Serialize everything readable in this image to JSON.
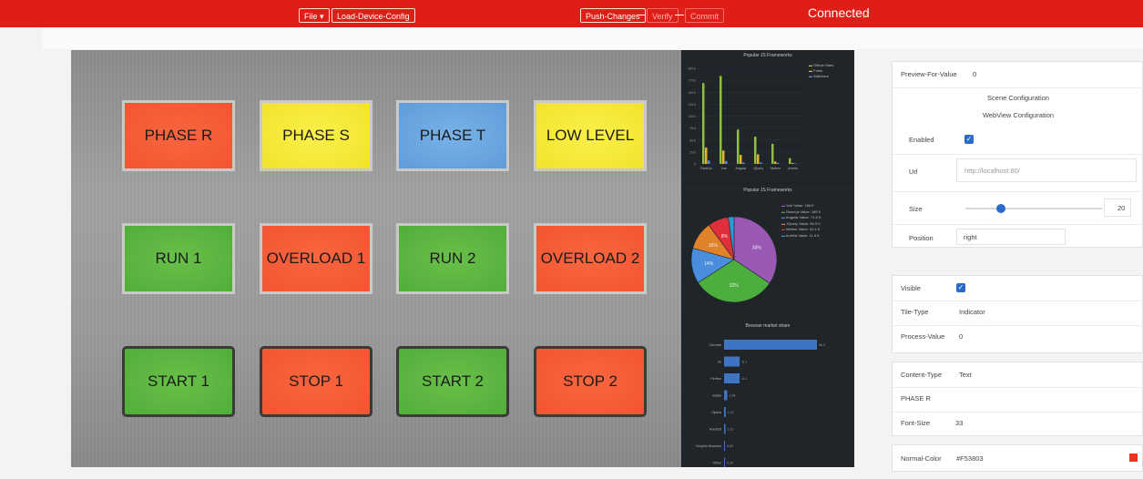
{
  "toolbar": {
    "file_label": "File ▾",
    "load_label": "Load-Device-Config",
    "push_label": "Push-Changes",
    "verify_label": "Verify",
    "commit_label": "Commit",
    "status": "Connected"
  },
  "tiles": [
    {
      "label": "PHASE R",
      "color": "#F25533"
    },
    {
      "label": "PHASE S",
      "color": "#F1E32A"
    },
    {
      "label": "PHASE T",
      "color": "#5F9CD8"
    },
    {
      "label": "LOW LEVEL",
      "color": "#F1E32A"
    },
    {
      "label": "RUN 1",
      "color": "#52AD39"
    },
    {
      "label": "OVERLOAD 1",
      "color": "#F25533"
    },
    {
      "label": "RUN 2",
      "color": "#52AD39"
    },
    {
      "label": "OVERLOAD 2",
      "color": "#F25533"
    },
    {
      "label": "START 1",
      "color": "#52AD39"
    },
    {
      "label": "STOP 1",
      "color": "#F25533"
    },
    {
      "label": "START 2",
      "color": "#52AD39"
    },
    {
      "label": "STOP 2",
      "color": "#F25533"
    }
  ],
  "charts": {
    "bar_title": "Popular JS Frameworks",
    "bar_legend": [
      "Github Stars",
      "Forks",
      "Watchers"
    ],
    "bar_categories": [
      "React.js",
      "Vue",
      "Angular",
      "JQuery",
      "Meteor",
      "Aurelia"
    ],
    "bar_yticks": [
      "200 k",
      "175 k",
      "150 k",
      "125 k",
      "100 k",
      "75 k",
      "50 k",
      "25 k",
      "0"
    ],
    "pie_title": "Popular JS Frameworks",
    "pie_legend": [
      "Vue   Value: 184 K",
      "React.js  Value: 169 K",
      "Angular  Value: 71.6 K",
      "JQuery  Value: 56.9 K",
      "Meteor  Value: 42.4 K",
      "Aurelia  Value: 11.6 K"
    ],
    "pie_labels": [
      "34%",
      "32%",
      "14%",
      "10%",
      "8%"
    ],
    "hbar_title": "Browser market share",
    "hbar_categories": [
      "Chrome",
      "IE",
      "Firefox",
      "Safari",
      "Opera",
      "Android",
      "Dolphin Browser",
      "Other"
    ],
    "hbar_values": [
      "66.3",
      "11.1",
      "11.1",
      "2.34",
      "1.21",
      "1.01",
      "0.63",
      "0.28"
    ]
  },
  "chart_data": [
    {
      "type": "bar",
      "title": "Popular JS Frameworks",
      "categories": [
        "React.js",
        "Vue",
        "Angular",
        "JQuery",
        "Meteor",
        "Aurelia"
      ],
      "ylim": [
        0,
        200
      ],
      "series": [
        {
          "name": "Github Stars",
          "values": [
            169,
            184,
            72,
            57,
            42,
            12
          ]
        },
        {
          "name": "Forks",
          "values": [
            34,
            28,
            19,
            20,
            5,
            2
          ]
        },
        {
          "name": "Watchers",
          "values": [
            7,
            6,
            3,
            3,
            2,
            1
          ]
        }
      ]
    },
    {
      "type": "pie",
      "title": "Popular JS Frameworks",
      "categories": [
        "Vue",
        "React.js",
        "Angular",
        "JQuery",
        "Meteor",
        "Aurelia"
      ],
      "values": [
        184,
        169,
        71.6,
        56.9,
        42.4,
        11.6
      ],
      "colors": [
        "#9b59b6",
        "#4cae3c",
        "#4a8ddc",
        "#e0822a",
        "#e02e3a",
        "#2a9bd8"
      ]
    },
    {
      "type": "bar",
      "title": "Browser market share",
      "categories": [
        "Chrome",
        "IE",
        "Firefox",
        "Safari",
        "Opera",
        "Android",
        "Dolphin Browser",
        "Other"
      ],
      "values": [
        66.3,
        11.1,
        11.1,
        2.34,
        1.21,
        1.01,
        0.63,
        0.28
      ]
    }
  ],
  "config": {
    "preview_label": "Preview-For-Value",
    "preview_value": "0",
    "scene_label": "Scene Configuration",
    "webview_label": "WebView Configuration",
    "enabled_label": "Enabled",
    "url_label": "Url",
    "url_placeholder": "http://localhost:80/",
    "size_label": "Size",
    "size_value": "20",
    "size_fraction": 0.26,
    "position_label": "Position",
    "position_value": "right",
    "visible_label": "Visible",
    "tile_type_label": "Tile-Type",
    "tile_type_value": "Indicator",
    "process_label": "Process-Value",
    "process_value": "0",
    "content_type_label": "Content-Type",
    "content_type_value": "Text",
    "content_text": "PHASE R",
    "font_size_label": "Font-Size",
    "font_size_value": "33",
    "normal_color_label": "Normal-Color",
    "normal_color_value": "#F53803",
    "normal_color_swatch": "#E8341C"
  }
}
